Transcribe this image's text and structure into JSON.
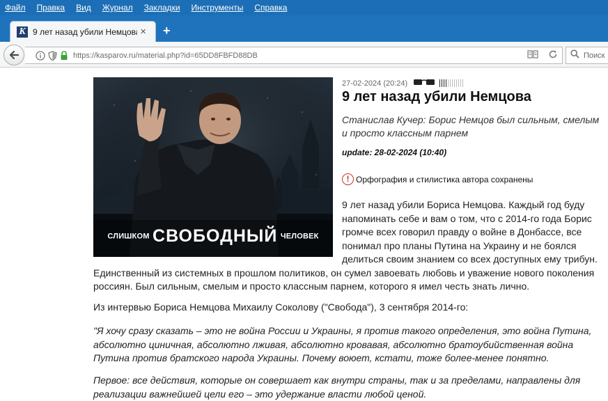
{
  "menu": [
    "Файл",
    "Правка",
    "Вид",
    "Журнал",
    "Закладки",
    "Инструменты",
    "Справка"
  ],
  "tab": {
    "favicon_letter": "K",
    "title": "9 лет назад убили Немцова ...",
    "close": "✕"
  },
  "new_tab": "+",
  "url": "https://kasparov.ru/material.php?id=65DD8FBFD88DB",
  "search_placeholder": "Поиск",
  "article": {
    "date": "27-02-2024 (20:24)",
    "rating": 4,
    "rating_max": 12,
    "title": "9 лет назад убили Немцова",
    "subtitle": "Станислав Кучер: Борис Немцов был сильным, смелым и просто классным парнем",
    "update": "update: 28-02-2024 (10:40)",
    "notice_icon": "!",
    "notice": "Орфография и стилистика автора сохранены",
    "image_caption": {
      "left": "СЛИШКОМ",
      "big": "СВОБОДНЫЙ",
      "right": "ЧЕЛОВЕК"
    },
    "lead_lines": [
      "9 лет назад убили Бориса Немцова. Каждый год буду",
      "напоминать себе и вам о том, что с 2014-го года Борис",
      "громче всех говорил правду о войне в Донбассе, все",
      "понимал про планы Путина на Украину и не боялся",
      "делиться своим знанием со всех доступных ему трибун."
    ],
    "lead_continuation": "Единственный из системных в прошлом политиков, он сумел завоевать любовь и уважение нового поколения россиян. Был сильным, смелым и просто классным парнем, которого я имел честь знать лично.",
    "interview_intro": "Из интервью Бориса Немцова Михаилу Соколову (\"Свобода\"), 3 сентября 2014-го:",
    "quote1": "\"Я хочу сразу сказать – это не война России и Украины, я против такого определения, это война Путина, абсолютно циничная, абсолютно лживая, абсолютно кровавая, абсолютно братоубийственная война Путина против братского народа Украины. Почему воюет, кстати, тоже более-менее понятно.",
    "quote2": "Первое: все действия, которые он совершает как внутри страны, так и за пределами, направлены для реализации важнейшей цели его – это удержание власти любой ценой."
  },
  "colors": {
    "menubar": "#1c6fb6",
    "tabstrip": "#1f73bc",
    "warning": "#c4332b"
  }
}
